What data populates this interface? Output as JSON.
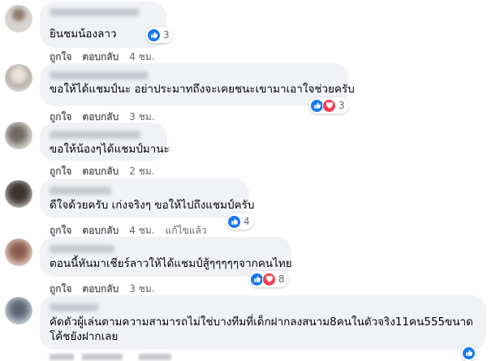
{
  "labels": {
    "like": "ถูกใจ",
    "reply": "ตอบกลับ",
    "edited": "แก้ไขแล้ว"
  },
  "colors": {
    "like": "#1877f2",
    "love": "#f33e58",
    "bubble": "#f0f2f5",
    "meta": "#65676b"
  },
  "comments": [
    {
      "text": "ยินชมน้องลาว",
      "reaction_count": "3",
      "reactions": [
        "like-icon"
      ],
      "time": "4 ชม."
    },
    {
      "text": "ขอให้ได้แชมป์นะ อย่าประมาทถึงจะเคยชนะเขามาเอาใจช่วยครับ",
      "reaction_count": "3",
      "reactions": [
        "like-icon",
        "love-icon"
      ],
      "time": "3 ชม."
    },
    {
      "text": "ขอให้น้องๆได้แชมป์มานะ",
      "reaction_count": "",
      "reactions": [],
      "time": "2 ชม."
    },
    {
      "text": "ดีใจด้วยครับ เก่งจริงๆ ขอให้ไปถึงแชมป์ครับ",
      "reaction_count": "4",
      "reactions": [
        "like-icon"
      ],
      "time": "4 ชม."
    },
    {
      "text": "ตอนนี้หันมาเชียร์ลาวให้ได้แชมป์สู้ๆๆๆๆๆจากคนไทย",
      "reaction_count": "8",
      "reactions": [
        "like-icon",
        "love-icon"
      ],
      "time": "3 ชม."
    },
    {
      "text": "คัดตัวผู้เล่นตามความสามารถไม่ใช่บางทีมที่เด็กฝากลงสนาม8คนในตัวจริง11คน555ขนาดโค้ชยังฝากเลย",
      "reaction_count": "",
      "reactions": [
        "like-icon"
      ],
      "time": ""
    }
  ]
}
